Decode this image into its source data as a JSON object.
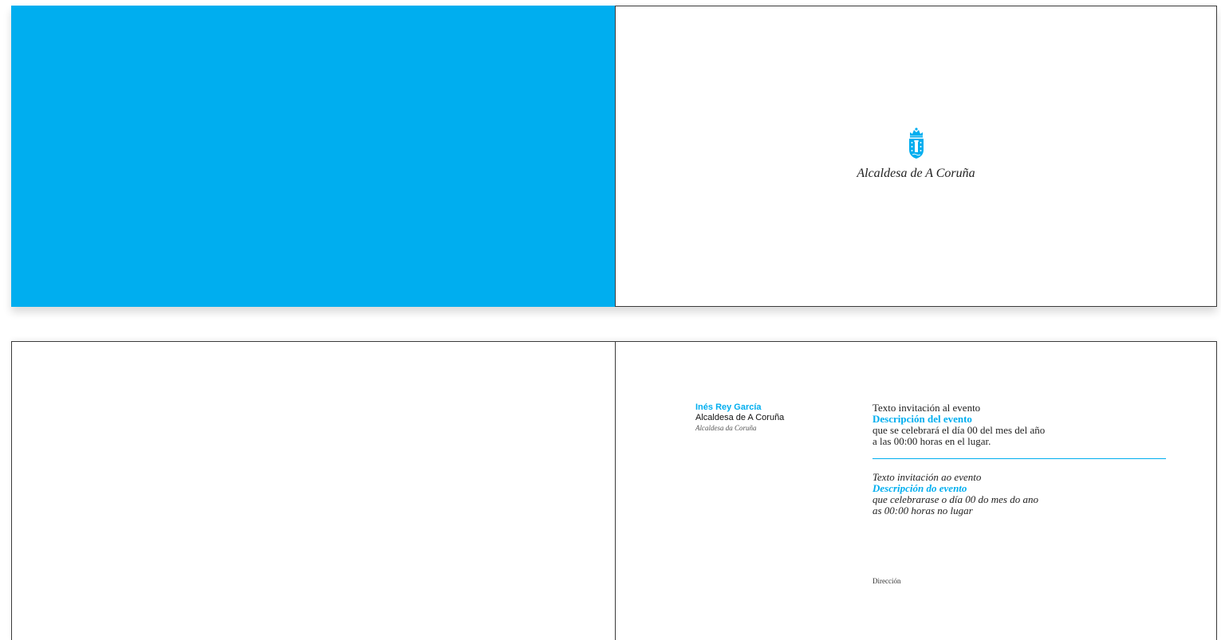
{
  "cover": {
    "crest_icon": "coat-of-arms-icon",
    "accent_color": "#00aeef",
    "title": "Alcaldesa de A Coruña"
  },
  "sender": {
    "name": "Inés Rey García",
    "role_es": "Alcaldesa de A Coruña",
    "role_gl": "Alcaldesa da Coruña"
  },
  "invitation_es": {
    "intro": "Texto invitación al evento",
    "event": "Descripción del evento",
    "line1": "que se celebrará el día 00 del mes del año",
    "line2": "a las 00:00 horas en el lugar."
  },
  "invitation_gl": {
    "intro": "Texto invitación ao evento",
    "event": "Descripción do evento",
    "line1": "que celebrarase o día 00 do mes do ano",
    "line2": "as 00:00 horas no lugar"
  },
  "address_label": "Dirección"
}
